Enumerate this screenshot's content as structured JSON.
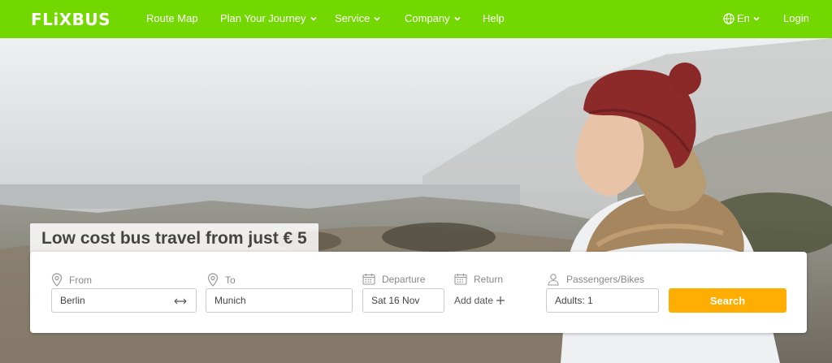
{
  "nav": {
    "logo": "FLiXBUS",
    "items": [
      {
        "label": "Route Map",
        "dropdown": false
      },
      {
        "label": "Plan Your Journey",
        "dropdown": true
      },
      {
        "label": "Service",
        "dropdown": true
      },
      {
        "label": "Company",
        "dropdown": true
      },
      {
        "label": "Help",
        "dropdown": false
      }
    ],
    "language": "En",
    "login": "Login",
    "color": "#73d700"
  },
  "hero": {
    "headline": "Low cost bus travel from just € 5"
  },
  "search": {
    "from_label": "From",
    "from_value": "Berlin",
    "to_label": "To",
    "to_value": "Munich",
    "departure_label": "Departure",
    "departure_value": "Sat 16 Nov",
    "return_label": "Return",
    "return_action": "Add date",
    "passengers_label": "Passengers/Bikes",
    "passengers_value": "Adults: 1",
    "search_button": "Search",
    "button_color": "#ffad00"
  }
}
